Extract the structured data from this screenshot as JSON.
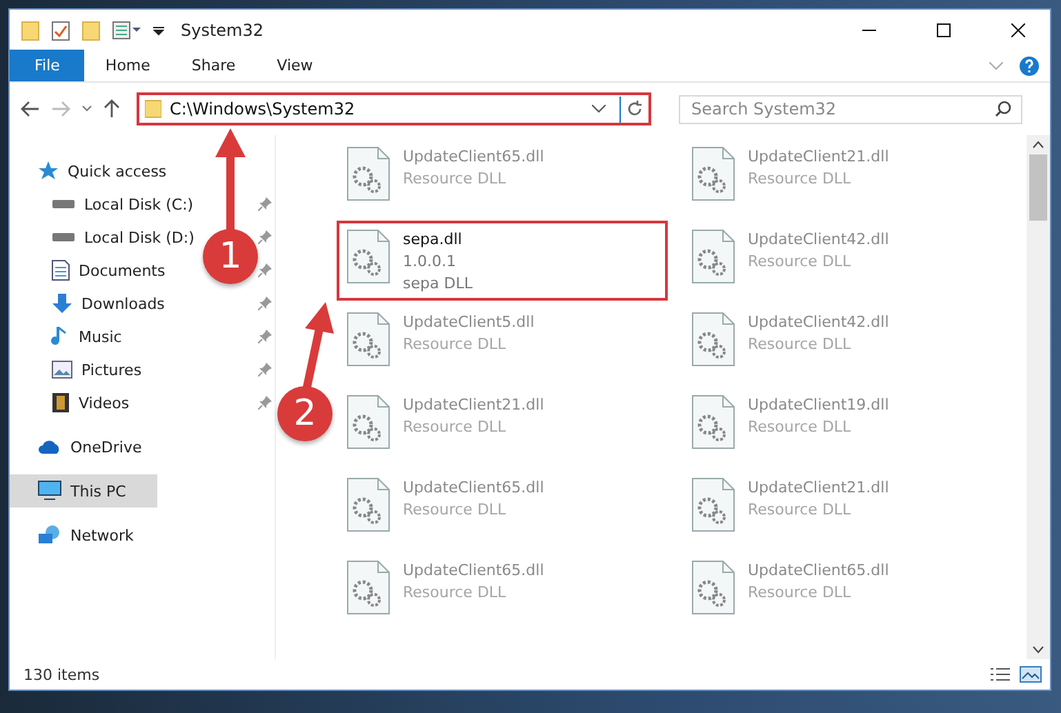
{
  "window": {
    "title": "System32"
  },
  "ribbon_tabs": [
    {
      "label": "File",
      "kind": "file"
    },
    {
      "label": "Home",
      "kind": "tab"
    },
    {
      "label": "Share",
      "kind": "tab"
    },
    {
      "label": "View",
      "kind": "tab"
    }
  ],
  "address": {
    "path": "C:\\Windows\\System32",
    "highlighted": true
  },
  "search": {
    "placeholder": "Search System32"
  },
  "sidebar": {
    "items": [
      {
        "label": "Quick access",
        "kind": "star",
        "pinned": false,
        "selected": false
      },
      {
        "label": "Local Disk (C:)",
        "kind": "disk",
        "pinned": true,
        "selected": false
      },
      {
        "label": "Local Disk (D:)",
        "kind": "disk",
        "pinned": true,
        "selected": false
      },
      {
        "label": "Documents",
        "kind": "documents",
        "pinned": true,
        "selected": false
      },
      {
        "label": "Downloads",
        "kind": "downloads",
        "pinned": true,
        "selected": false
      },
      {
        "label": "Music",
        "kind": "music",
        "pinned": true,
        "selected": false
      },
      {
        "label": "Pictures",
        "kind": "pictures",
        "pinned": true,
        "selected": false
      },
      {
        "label": "Videos",
        "kind": "videos",
        "pinned": true,
        "selected": false
      },
      {
        "label": "OneDrive",
        "kind": "cloud",
        "pinned": false,
        "selected": false
      },
      {
        "label": "This PC",
        "kind": "pc",
        "pinned": false,
        "selected": true
      },
      {
        "label": "Network",
        "kind": "network",
        "pinned": false,
        "selected": false
      }
    ]
  },
  "files": [
    {
      "name": "UpdateClient65.dll",
      "lines": [
        "Resource DLL"
      ],
      "highlighted": false
    },
    {
      "name": "UpdateClient21.dll",
      "lines": [
        "Resource DLL"
      ],
      "highlighted": false
    },
    {
      "name": "sepa.dll",
      "lines": [
        "1.0.0.1",
        "sepa DLL"
      ],
      "highlighted": true
    },
    {
      "name": "UpdateClient42.dll",
      "lines": [
        "Resource DLL"
      ],
      "highlighted": false
    },
    {
      "name": "UpdateClient5.dll",
      "lines": [
        "Resource DLL"
      ],
      "highlighted": false
    },
    {
      "name": "UpdateClient42.dll",
      "lines": [
        "Resource DLL"
      ],
      "highlighted": false
    },
    {
      "name": "UpdateClient21.dll",
      "lines": [
        "Resource DLL"
      ],
      "highlighted": false
    },
    {
      "name": "UpdateClient19.dll",
      "lines": [
        "Resource DLL"
      ],
      "highlighted": false
    },
    {
      "name": "UpdateClient65.dll",
      "lines": [
        "Resource DLL"
      ],
      "highlighted": false
    },
    {
      "name": "UpdateClient21.dll",
      "lines": [
        "Resource DLL"
      ],
      "highlighted": false
    },
    {
      "name": "UpdateClient65.dll",
      "lines": [
        "Resource DLL"
      ],
      "highlighted": false
    },
    {
      "name": "UpdateClient65.dll",
      "lines": [
        "Resource DLL"
      ],
      "highlighted": false
    }
  ],
  "status_bar": {
    "count": "130 items"
  },
  "callouts": [
    {
      "label": "1"
    },
    {
      "label": "2"
    }
  ]
}
